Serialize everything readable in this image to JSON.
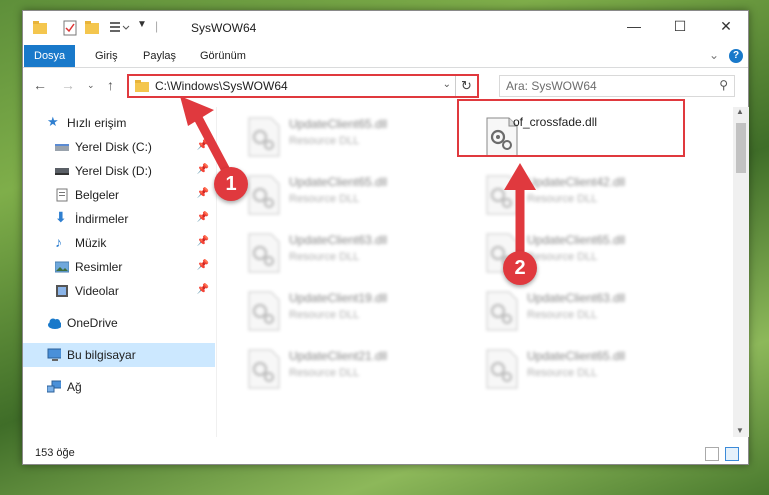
{
  "window": {
    "title": "SysWOW64",
    "controls": {
      "minimize": "—",
      "maximize": "☐",
      "close": "✕"
    }
  },
  "ribbon": {
    "tabs": [
      "Dosya",
      "Giriş",
      "Paylaş",
      "Görünüm"
    ],
    "active_tab": "Dosya",
    "collapse_glyph": "⌄",
    "help_glyph": "?"
  },
  "address": {
    "path": "C:\\Windows\\SysWOW64",
    "search_placeholder": "Ara: SysWOW64"
  },
  "sidebar": {
    "items": [
      {
        "label": "Hızlı erişim",
        "icon": "star-icon",
        "pinned": false
      },
      {
        "label": "Yerel Disk (C:)",
        "icon": "drive-icon",
        "pinned": true
      },
      {
        "label": "Yerel Disk (D:)",
        "icon": "drive-icon",
        "pinned": true
      },
      {
        "label": "Belgeler",
        "icon": "documents-icon",
        "pinned": true
      },
      {
        "label": "İndirmeler",
        "icon": "download-icon",
        "pinned": true
      },
      {
        "label": "Müzik",
        "icon": "music-icon",
        "pinned": true
      },
      {
        "label": "Resimler",
        "icon": "pictures-icon",
        "pinned": true
      },
      {
        "label": "Videolar",
        "icon": "videos-icon",
        "pinned": true
      },
      {
        "label": "OneDrive",
        "icon": "cloud-icon",
        "pinned": false
      },
      {
        "label": "Bu bilgisayar",
        "icon": "computer-icon",
        "pinned": false,
        "selected": true
      },
      {
        "label": "Ağ",
        "icon": "network-icon",
        "pinned": false
      }
    ]
  },
  "files": {
    "left_column": [
      {
        "name": "UpdateClient65.dll",
        "type": "Resource DLL"
      },
      {
        "name": "UpdateClient65.dll",
        "type": "Resource DLL"
      },
      {
        "name": "UpdateClient63.dll",
        "type": "Resource DLL"
      },
      {
        "name": "UpdateClient19.dll",
        "type": "Resource DLL"
      },
      {
        "name": "UpdateClient21.dll",
        "type": "Resource DLL"
      }
    ],
    "right_column": [
      {
        "name": "of_crossfade.dll",
        "type": "",
        "highlighted": true
      },
      {
        "name": "UpdateClient42.dll",
        "type": "Resource DLL"
      },
      {
        "name": "UpdateClient65.dll",
        "type": "Resource DLL"
      },
      {
        "name": "UpdateClient63.dll",
        "type": "Resource DLL"
      },
      {
        "name": "UpdateClient65.dll",
        "type": "Resource DLL"
      }
    ]
  },
  "status": {
    "item_count": "153 öğe"
  },
  "annotations": {
    "step1": "1",
    "step2": "2",
    "color": "#e0393e"
  },
  "colors": {
    "accent": "#1979ca",
    "selection": "#cce8ff",
    "annotation": "#e0393e"
  }
}
